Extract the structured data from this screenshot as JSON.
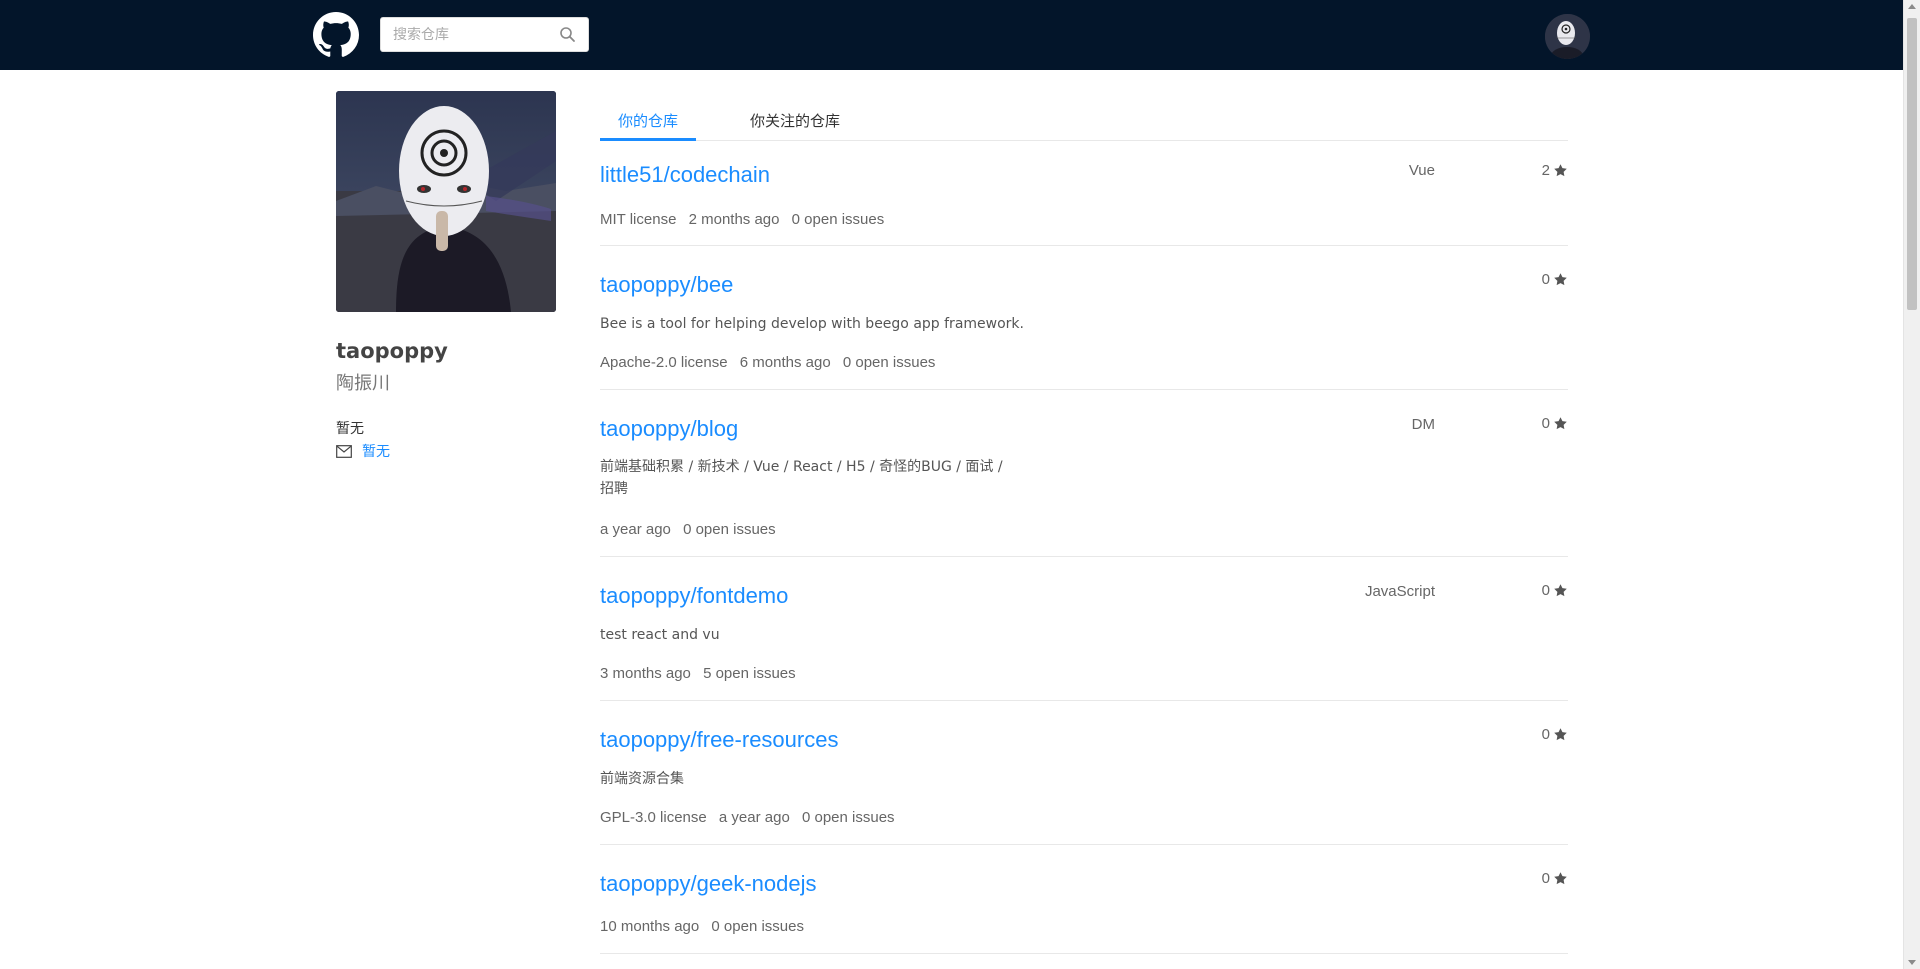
{
  "header": {
    "search_placeholder": "搜索仓库"
  },
  "profile": {
    "username": "taopoppy",
    "real_name": "陶振川",
    "bio": "暂无",
    "email": "暂无"
  },
  "tabs": [
    {
      "label": "你的仓库",
      "active": true
    },
    {
      "label": "你关注的仓库",
      "active": false
    }
  ],
  "repos": [
    {
      "name": "little51/codechain",
      "language": "Vue",
      "stars": "2",
      "description": "",
      "license": "MIT license",
      "updated": "2 months ago",
      "issues": "0 open issues"
    },
    {
      "name": "taopoppy/bee",
      "language": "",
      "stars": "0",
      "description": "Bee is a tool for helping develop with beego app framework.",
      "license": "Apache-2.0 license",
      "updated": "6 months ago",
      "issues": "0 open issues"
    },
    {
      "name": "taopoppy/blog",
      "language": "DM",
      "stars": "0",
      "description_line1": "前端基础积累 / 新技术 / Vue / React / H5 / 奇怪的BUG / 面试 /",
      "description_line2": "招聘",
      "license": "",
      "updated": "a year ago",
      "issues": "0 open issues"
    },
    {
      "name": "taopoppy/fontdemo",
      "language": "JavaScript",
      "stars": "0",
      "description": "test react and vu",
      "license": "",
      "updated": "3 months ago",
      "issues": "5 open issues"
    },
    {
      "name": "taopoppy/free-resources",
      "language": "",
      "stars": "0",
      "description": "前端资源合集",
      "license": "GPL-3.0 license",
      "updated": "a year ago",
      "issues": "0 open issues"
    },
    {
      "name": "taopoppy/geek-nodejs",
      "language": "",
      "stars": "0",
      "description": "",
      "license": "",
      "updated": "10 months ago",
      "issues": "0 open issues"
    }
  ],
  "colors": {
    "header_bg": "#03152a",
    "link": "#1a8cff",
    "divider": "#e8e8e8"
  }
}
